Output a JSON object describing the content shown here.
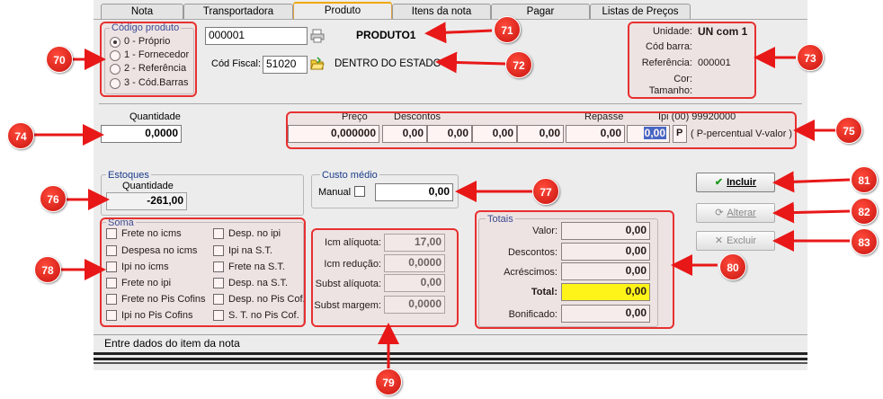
{
  "tabs": [
    "Nota",
    "Transportadora",
    "Produto",
    "Itens da nota",
    "Pagar",
    "Listas de Preços"
  ],
  "codigo": {
    "legend": "Código produto",
    "options": [
      "0 - Próprio",
      "1 - Fornecedor",
      "2 - Referência",
      "3 - Cód.Barras"
    ],
    "selected": 0
  },
  "product": {
    "code": "000001",
    "name": "PRODUTO1",
    "cod_fiscal_label": "Cód Fiscal:",
    "cod_fiscal": "51020",
    "fiscal_desc": "DENTRO DO ESTADO"
  },
  "info": {
    "unidade_label": "Unidade:",
    "unidade": "UN com 1",
    "codbarra_label": "Cód barra:",
    "codbarra": "",
    "referencia_label": "Referência:",
    "referencia": "000001",
    "cor_label": "Cor:",
    "cor": "",
    "tamanho_label": "Tamanho:",
    "tamanho": ""
  },
  "quantidade": {
    "label": "Quantidade",
    "value": "0,0000"
  },
  "preco": {
    "preco_label": "Preço",
    "descontos_label": "Descontos",
    "repasse_label": "Repasse",
    "ipi_label": "Ipi (00) 99920000",
    "preco": "0,000000",
    "desc": [
      "0,00",
      "0,00",
      "0,00",
      "0,00"
    ],
    "repasse": "0,00",
    "ipi": "0,00",
    "p_label": "P",
    "p_desc": "( P-percentual V-valor )"
  },
  "estoques": {
    "legend": "Estoques",
    "qty_label": "Quantidade",
    "qty": "-261,00"
  },
  "custo": {
    "legend": "Custo médio",
    "manual_label": "Manual",
    "value": "0,00"
  },
  "soma": {
    "legend": "Soma",
    "left": [
      "Frete no icms",
      "Despesa no icms",
      "Ipi no icms",
      "Frete no ipi",
      "Frete no Pis Cofins",
      "Ipi no Pis Cofins"
    ],
    "right": [
      "Desp. no ipi",
      "Ipi na S.T.",
      "Frete na S.T.",
      "Desp. na S.T.",
      "Desp. no Pis Cof.",
      "S. T. no Pis Cof."
    ]
  },
  "icms": {
    "icm_aliquota_label": "Icm alíquota:",
    "icm_aliquota": "17,00",
    "icm_reducao_label": "Icm redução:",
    "icm_reducao": "0,0000",
    "subst_aliquota_label": "Subst alíquota:",
    "subst_aliquota": "0,00",
    "subst_margem_label": "Subst margem:",
    "subst_margem": "0,0000"
  },
  "totais": {
    "legend": "Totais",
    "valor_label": "Valor:",
    "valor": "0,00",
    "descontos_label": "Descontos:",
    "descontos": "0,00",
    "acrescimos_label": "Acréscimos:",
    "acrescimos": "0,00",
    "total_label": "Total:",
    "total": "0,00",
    "bonificado_label": "Bonificado:",
    "bonificado": "0,00"
  },
  "buttons": {
    "incluir": "Incluir",
    "alterar": "Alterar",
    "excluir": "Excluir"
  },
  "status": "Entre dados do item da nota",
  "badges": [
    "70",
    "71",
    "72",
    "73",
    "74",
    "75",
    "76",
    "77",
    "78",
    "79",
    "80",
    "81",
    "82",
    "83"
  ],
  "colors": {
    "highlight": "#e83030",
    "total_bg": "#ffff00",
    "legend": "#1a3a8a"
  }
}
